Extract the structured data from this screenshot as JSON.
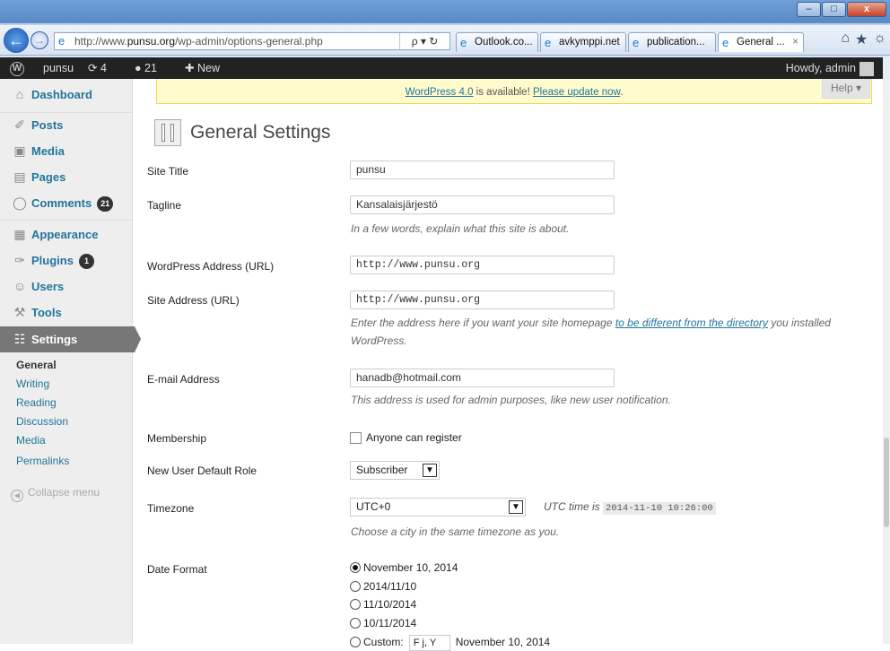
{
  "browser": {
    "url_prefix": "http://www.",
    "url_domain": "punsu.org",
    "url_path": "/wp-admin/options-general.php",
    "search_refresh": "ρ ▾ ↻",
    "tabs": [
      {
        "label": "Outlook.co..."
      },
      {
        "label": "avkymppi.net"
      },
      {
        "label": "publication..."
      },
      {
        "label": "General ..."
      }
    ],
    "tab_close": "×",
    "window_buttons": [
      "–",
      "□",
      "x"
    ]
  },
  "adminbar": {
    "site": "punsu",
    "updates": "4",
    "comments": "21",
    "new": "New",
    "howdy": "Howdy, admin"
  },
  "notice": {
    "link": "WordPress 4.0",
    "text": " is available! ",
    "update_link": "Please update now",
    "end": "."
  },
  "help": "Help ▾",
  "sidebar": {
    "items": [
      {
        "label": "Dashboard",
        "icon": "⌂"
      },
      {
        "label": "Posts",
        "icon": "✐"
      },
      {
        "label": "Media",
        "icon": "▣"
      },
      {
        "label": "Pages",
        "icon": "▤"
      },
      {
        "label": "Comments",
        "icon": "◯",
        "count": "21"
      },
      {
        "label": "Appearance",
        "icon": "▦"
      },
      {
        "label": "Plugins",
        "icon": "✑",
        "count": "1"
      },
      {
        "label": "Users",
        "icon": "☺"
      },
      {
        "label": "Tools",
        "icon": "⚒"
      },
      {
        "label": "Settings",
        "icon": "☷"
      }
    ],
    "submenu": [
      "General",
      "Writing",
      "Reading",
      "Discussion",
      "Media",
      "Permalinks"
    ],
    "collapse": "Collapse menu"
  },
  "page": {
    "title": "General Settings",
    "fields": {
      "site_title": {
        "label": "Site Title",
        "value": "punsu"
      },
      "tagline": {
        "label": "Tagline",
        "value": "Kansalaisjärjestö",
        "desc": "In a few words, explain what this site is about."
      },
      "wp_url": {
        "label": "WordPress Address (URL)",
        "value": "http://www.punsu.org"
      },
      "site_url": {
        "label": "Site Address (URL)",
        "value": "http://www.punsu.org",
        "desc_a": "Enter the address here if you want your site homepage ",
        "desc_link": "to be different from the directory",
        "desc_b": " you installed",
        "desc_c": "WordPress."
      },
      "email": {
        "label": "E-mail Address",
        "value": "hanadb@hotmail.com",
        "desc": "This address is used for admin purposes, like new user notification."
      },
      "membership": {
        "label": "Membership",
        "option": "Anyone can register"
      },
      "role": {
        "label": "New User Default Role",
        "value": "Subscriber"
      },
      "timezone": {
        "label": "Timezone",
        "value": "UTC+0",
        "utc_label": "UTC time is ",
        "utc_time": "2014-11-10 10:26:00",
        "desc": "Choose a city in the same timezone as you."
      },
      "date_format": {
        "label": "Date Format",
        "options": [
          "November 10, 2014",
          "2014/11/10",
          "11/10/2014",
          "10/11/2014"
        ],
        "custom_label": "Custom:",
        "custom_value": "F j, Y",
        "custom_preview": "November 10, 2014"
      }
    }
  }
}
